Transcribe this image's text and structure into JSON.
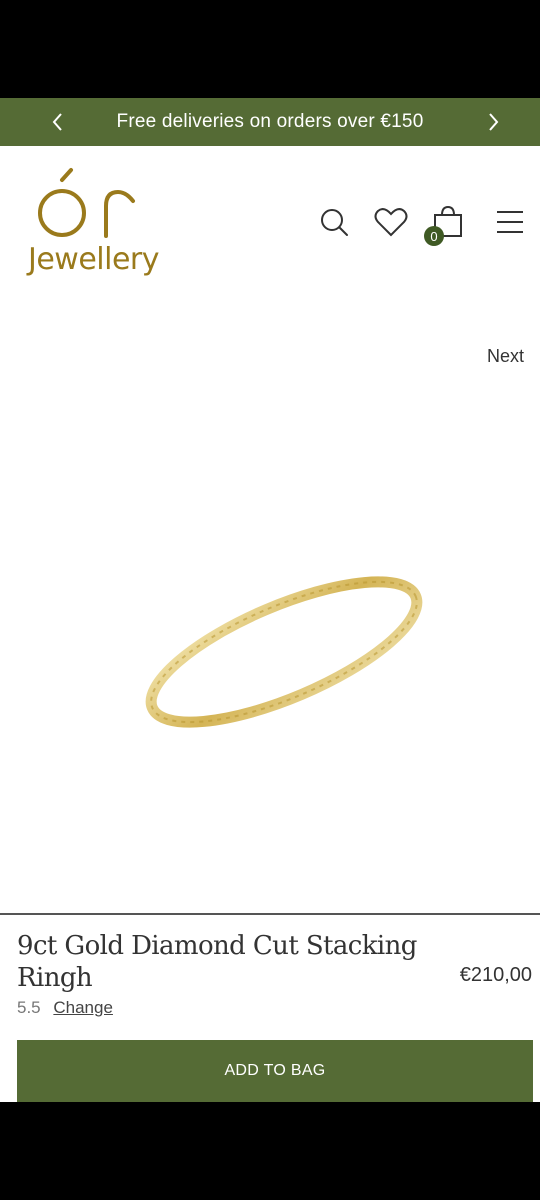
{
  "promo": {
    "text": "Free deliveries on orders over €150",
    "prev_icon": "chevron-left-icon",
    "next_icon": "chevron-right-icon"
  },
  "header": {
    "logo_mark": "ÓΓ",
    "logo_word": "Jewellery",
    "icons": [
      "search-icon",
      "heart-icon",
      "shopping-bag-icon",
      "menu-icon"
    ],
    "bag_count": "0"
  },
  "gallery": {
    "next_label": "Next"
  },
  "product": {
    "title": "9ct Gold Diamond Cut Stacking Ringh",
    "price": "€210,00",
    "size": "5.5",
    "change_label": "Change",
    "add_to_bag_label": "ADD TO BAG"
  },
  "colors": {
    "brand_green": "#556b35",
    "badge_green": "#3f5a24",
    "logo_gold": "#9a7a1c"
  }
}
